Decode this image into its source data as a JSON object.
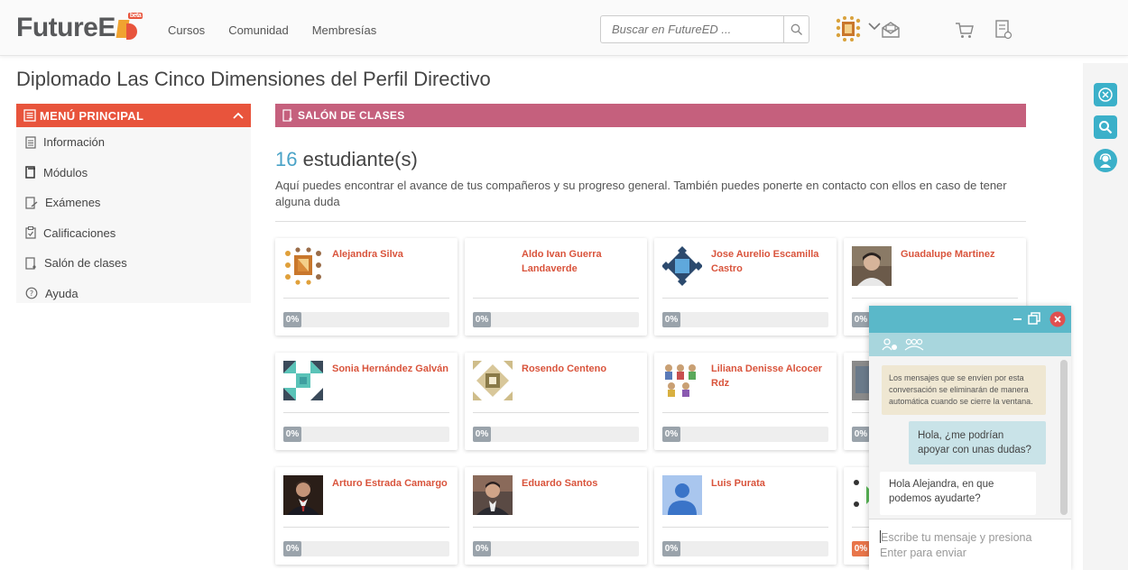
{
  "header": {
    "logo_text": "FutureE",
    "logo_badge": "beta",
    "nav": [
      "Cursos",
      "Comunidad",
      "Membresías"
    ],
    "search_placeholder": "Buscar en FutureED ..."
  },
  "page_title": "Diplomado Las Cinco Dimensiones del Perfil Directivo",
  "sidebar": {
    "title": "MENÚ PRINCIPAL",
    "items": [
      {
        "label": "Información",
        "icon": "document-icon"
      },
      {
        "label": "Módulos",
        "icon": "modules-icon"
      },
      {
        "label": "Exámenes",
        "icon": "exam-icon"
      },
      {
        "label": "Calificaciones",
        "icon": "clipboard-icon"
      },
      {
        "label": "Salón de clases",
        "icon": "classroom-icon"
      },
      {
        "label": "Ayuda",
        "icon": "help-icon"
      }
    ]
  },
  "main": {
    "section_title": "SALÓN DE CLASES",
    "count": "16",
    "count_label": " estudiante(s)",
    "description": "Aquí puedes encontrar el avance de tus compañeros y su progreso general. También puedes ponerte en contacto con ellos en caso de tener alguna duda"
  },
  "students": [
    {
      "name": "Alejandra Silva",
      "progress": "0%",
      "avatar": "pattern-orange"
    },
    {
      "name": "Aldo Ivan Guerra Landaverde",
      "progress": "0%",
      "avatar": "none"
    },
    {
      "name": "Jose Aurelio Escamilla Castro",
      "progress": "0%",
      "avatar": "pattern-blue"
    },
    {
      "name": "Guadalupe Martinez",
      "progress": "0%",
      "avatar": "photo"
    },
    {
      "name": "Sonia Hernández Galván",
      "progress": "0%",
      "avatar": "pattern-teal"
    },
    {
      "name": "Rosendo Centeno",
      "progress": "0%",
      "avatar": "pattern-tan"
    },
    {
      "name": "Liliana Denisse Alcocer Rdz",
      "progress": "0%",
      "avatar": "drawing"
    },
    {
      "name": "",
      "progress": "0%",
      "avatar": "photo"
    },
    {
      "name": "Arturo Estrada Camargo",
      "progress": "0%",
      "avatar": "photo"
    },
    {
      "name": "Eduardo Santos",
      "progress": "0%",
      "avatar": "photo"
    },
    {
      "name": "Luis Purata",
      "progress": "0%",
      "avatar": "default-user"
    },
    {
      "name": "",
      "progress": "0%",
      "avatar": "pattern-green"
    }
  ],
  "chat": {
    "system_message": "Los mensajes que se envíen por esta conversación se eliminarán de manera automática cuando se cierre la ventana.",
    "outgoing": "Hola, ¿me podrían apoyar con unas dudas?",
    "incoming": "Hola Alejandra, en que podemos ayudarte?",
    "input_placeholder_1": "Escribe tu mensaje y presiona",
    "input_placeholder_2": "Enter para enviar"
  },
  "colors": {
    "brand_orange": "#e8543c",
    "salon_pink": "#c5607d",
    "accent_teal": "#3bb0c9",
    "student_name": "#d9543c"
  }
}
